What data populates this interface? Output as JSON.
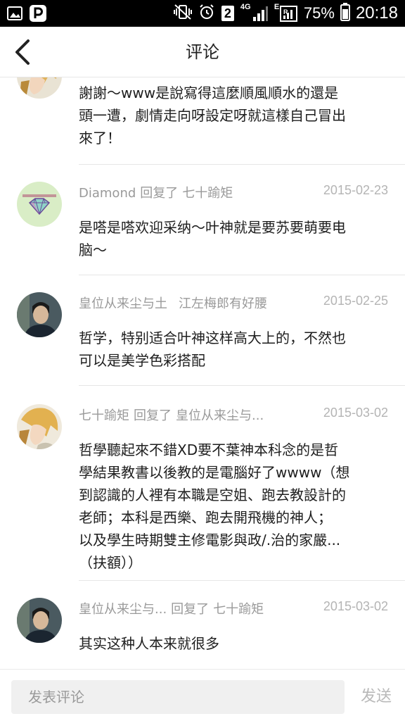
{
  "status_bar": {
    "network": "4G",
    "sim": "2",
    "data_type": "E",
    "battery_percent": "75%",
    "time": "20:18"
  },
  "header": {
    "title": "评论"
  },
  "comments": [
    {
      "author": "",
      "reply_label": "",
      "target": "",
      "date": "",
      "text_lines": [
        "謝謝～www是說寫得這麼順風順水的還是",
        "頭一遭，劇情走向呀設定呀就這樣自己冒出",
        "來了！"
      ]
    },
    {
      "author": "Diamond",
      "reply_label": "回复了",
      "target": "七十踰矩",
      "date": "2015-02-23",
      "text_lines": [
        "是嗒是嗒欢迎采纳～叶神就是要苏要萌要电",
        "脑～"
      ]
    },
    {
      "author": "皇位从来尘与土",
      "reply_label": "",
      "target": "江左梅郎有好腰",
      "date": "2015-02-25",
      "text_lines": [
        "哲学，特别适合叶神这样高大上的，不然也",
        "可以是美学色彩搭配"
      ]
    },
    {
      "author": "七十踰矩",
      "reply_label": "回复了",
      "target": "皇位从来尘与...",
      "date": "2015-03-02",
      "text_lines": [
        "哲學聽起來不錯XD要不葉神本科念的是哲",
        "學結果教書以後教的是電腦好了wwww（想",
        "到認識的人裡有本職是空姐、跑去教設計的",
        "老師；本科是西樂、跑去開飛機的神人；",
        "以及學生時期雙主修電影與政/.治的家嚴...",
        "（扶額））"
      ]
    },
    {
      "author": "皇位从来尘与...",
      "reply_label": "回复了",
      "target": "七十踰矩",
      "date": "2015-03-02",
      "text_lines": [
        "其实这种人本来就很多"
      ]
    }
  ],
  "bottom": {
    "input_placeholder": "发表评论",
    "send_label": "发送"
  }
}
